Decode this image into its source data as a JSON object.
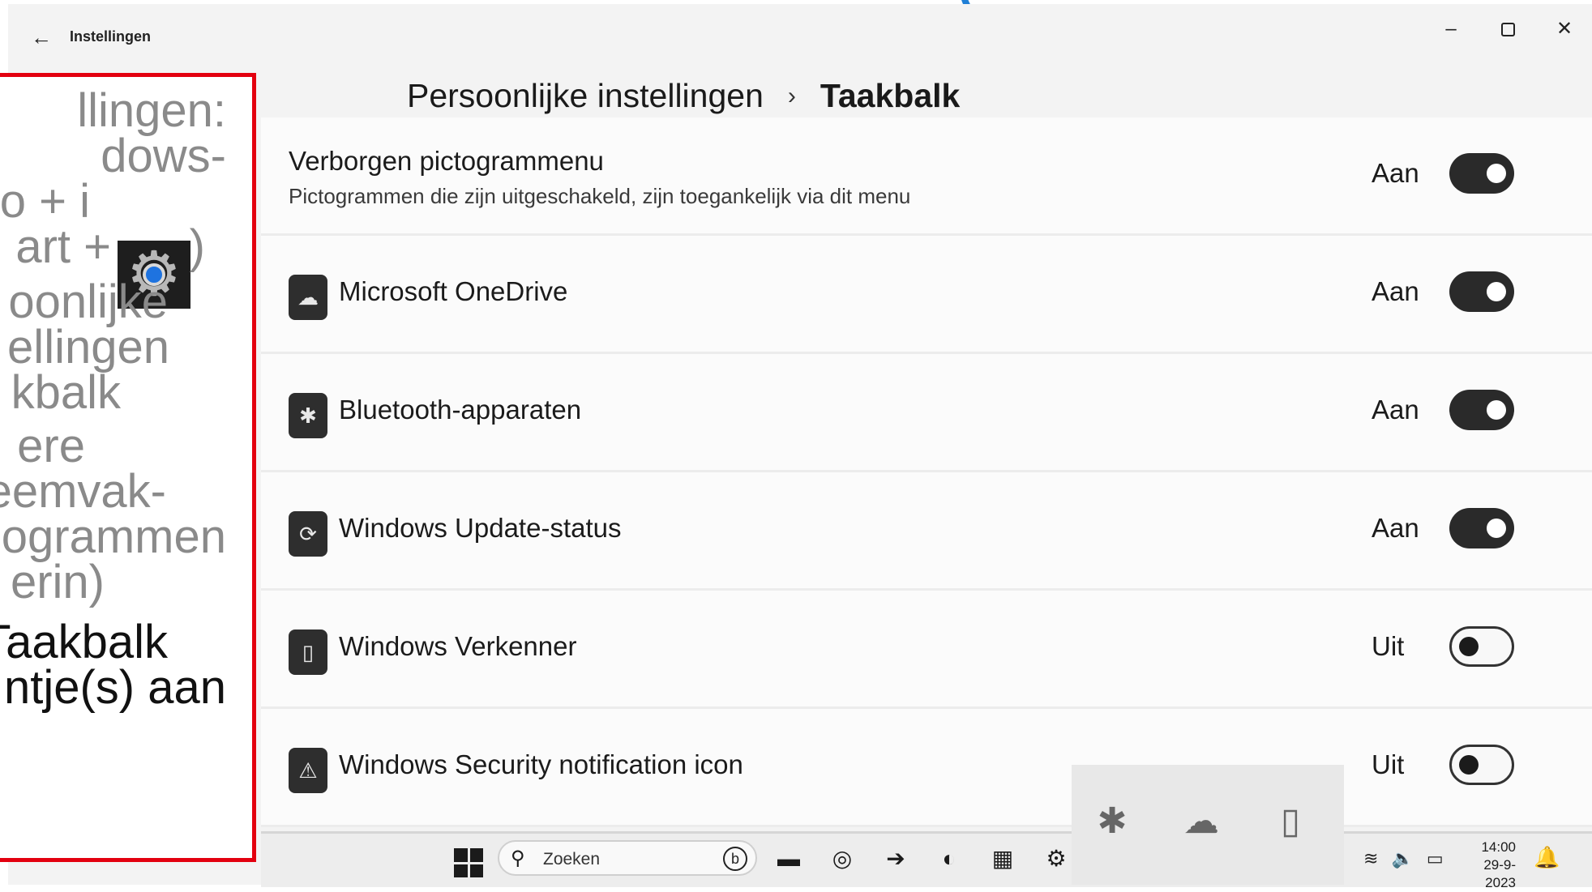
{
  "window": {
    "back_glyph": "←",
    "title": "Instellingen",
    "min_glyph": "–",
    "close_glyph": "✕"
  },
  "breadcrumb": {
    "parent": "Persoonlijke instellingen",
    "separator": "›",
    "current": "Taakbalk"
  },
  "header_row": {
    "title": "Verborgen pictogrammenu",
    "description": "Pictogrammen die zijn uitgeschakeld, zijn toegankelijk via dit menu",
    "state": "Aan"
  },
  "rows": [
    {
      "title": "Microsoft OneDrive",
      "state": "Aan",
      "icon": "onedrive-icon",
      "glyph": "☁"
    },
    {
      "title": "Bluetooth-apparaten",
      "state": "Aan",
      "icon": "bluetooth-icon",
      "glyph": "✱"
    },
    {
      "title": "Windows Update-status",
      "state": "Aan",
      "icon": "update-icon",
      "glyph": "⟳"
    },
    {
      "title": "Windows Verkenner",
      "state": "Uit",
      "icon": "usb-drive-icon",
      "glyph": "▯"
    },
    {
      "title": "Windows Security notification icon",
      "state": "Uit",
      "icon": "security-icon",
      "glyph": "⚠"
    }
  ],
  "instructions": {
    "lines": [
      "llingen:",
      "dows-",
      "o + i",
      "art +",
      ")",
      "oonlijke",
      "ellingen",
      "kbalk",
      "ere",
      "eemvak-",
      "ogrammen",
      "erin)",
      "Taakbalk",
      "ntje(s) aan"
    ]
  },
  "taskbar": {
    "search_placeholder": "Zoeken",
    "search_glyph": "⚲",
    "bing_glyph": "b",
    "time": "14:00",
    "date": "29-9-2023",
    "tray_glyphs": [
      "≋",
      "🔈",
      "▭"
    ],
    "bell_glyph": "🔔",
    "apps": [
      {
        "name": "file-explorer-icon",
        "glyph": "▬"
      },
      {
        "name": "clock-app-icon",
        "glyph": "◎"
      },
      {
        "name": "arrow-app-icon",
        "glyph": "➔"
      },
      {
        "name": "edge-icon",
        "glyph": "◐"
      },
      {
        "name": "store-icon",
        "glyph": "▦"
      },
      {
        "name": "settings-icon",
        "glyph": "⚙"
      }
    ]
  },
  "tray_popup": {
    "icons": [
      {
        "name": "bluetooth-icon",
        "glyph": "✱"
      },
      {
        "name": "onedrive-icon",
        "glyph": "☁"
      },
      {
        "name": "usb-drive-icon",
        "glyph": "▯"
      }
    ]
  },
  "colors": {
    "accent": "#1f7fd6",
    "highlight_border": "#e3000f",
    "toggle_on": "#2a2a2a"
  }
}
